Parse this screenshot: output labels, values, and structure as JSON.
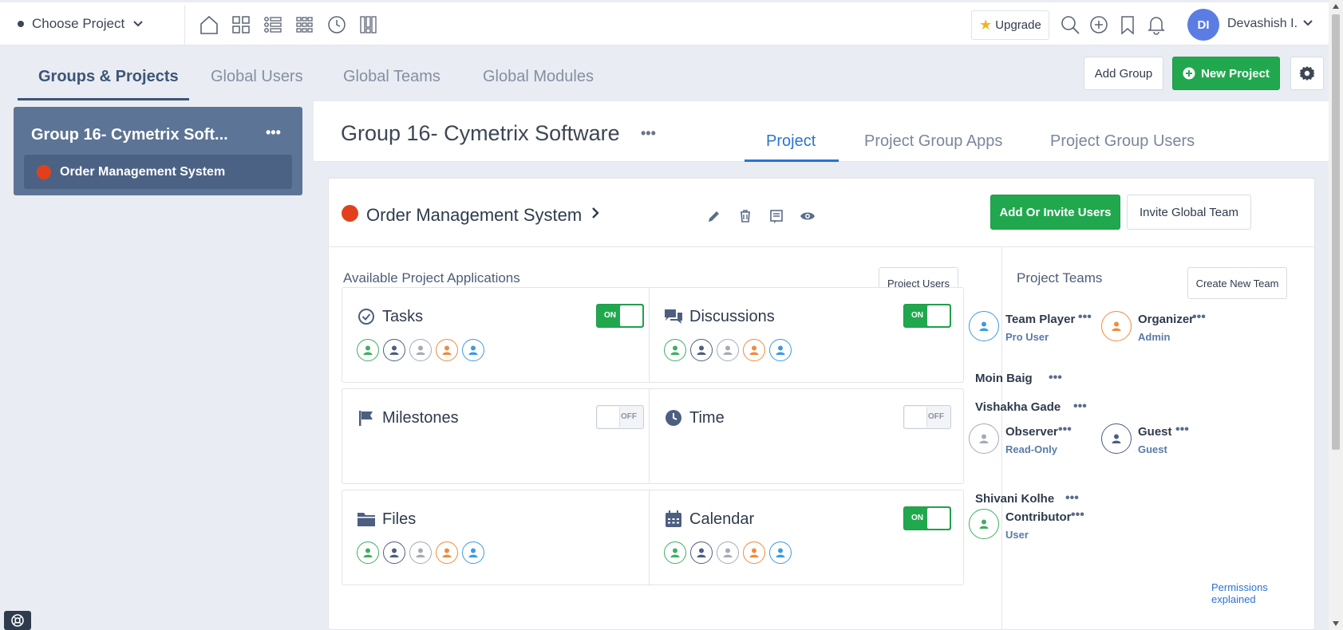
{
  "topbar": {
    "choose_project": "Choose Project",
    "upgrade": "Upgrade",
    "user_initials": "DI",
    "user_name": "Devashish I."
  },
  "global_tabs": [
    "Groups & Projects",
    "Global Users",
    "Global Teams",
    "Global Modules"
  ],
  "actions": {
    "add_group": "Add Group",
    "new_project": "New Project"
  },
  "sidebar": {
    "group_title": "Group 16- Cymetrix Soft...",
    "more": "•••",
    "project": "Order Management System"
  },
  "main": {
    "title": "Group 16- Cymetrix Software",
    "more": "•••",
    "tabs": [
      "Project",
      "Project Group Apps",
      "Project Group Users"
    ]
  },
  "project": {
    "name": "Order Management System",
    "add_invite": "Add Or Invite Users",
    "invite_team": "Invite Global Team"
  },
  "apps": {
    "title": "Available Project Applications",
    "project_users": "Project Users",
    "on_label": "ON",
    "off_label": "OFF",
    "items": [
      {
        "name": "Tasks",
        "state": "on",
        "icon": "check-circle-icon",
        "has_avatars": true
      },
      {
        "name": "Discussions",
        "state": "on",
        "icon": "chat-icon",
        "has_avatars": true
      },
      {
        "name": "Milestones",
        "state": "off",
        "icon": "flag-icon",
        "has_avatars": false
      },
      {
        "name": "Time",
        "state": "off",
        "icon": "clock-icon",
        "has_avatars": false
      },
      {
        "name": "Files",
        "state": "none",
        "icon": "folder-icon",
        "has_avatars": true
      },
      {
        "name": "Calendar",
        "state": "on",
        "icon": "calendar-icon",
        "has_avatars": true
      }
    ],
    "avatar_colors": [
      "#3fae62",
      "#4d5f80",
      "#a5abb6",
      "#f08a3c",
      "#3b9be0"
    ]
  },
  "teams": {
    "title": "Project Teams",
    "create": "Create New Team",
    "more": "•••",
    "roles": [
      {
        "name": "Team Player",
        "role": "Pro User",
        "color": "#3b9be0"
      },
      {
        "name": "Organizer",
        "role": "Admin",
        "color": "#f08a3c"
      },
      {
        "name": "Observer",
        "role": "Read-Only",
        "color": "#a5abb6"
      },
      {
        "name": "Guest",
        "role": "Guest",
        "color": "#4d5f80"
      },
      {
        "name": "Contributor",
        "role": "User",
        "color": "#3fae62"
      }
    ],
    "members": [
      "Moin Baig",
      "Vishakha Gade",
      "Shivani Kolhe"
    ],
    "permissions": "Permissions explained"
  }
}
